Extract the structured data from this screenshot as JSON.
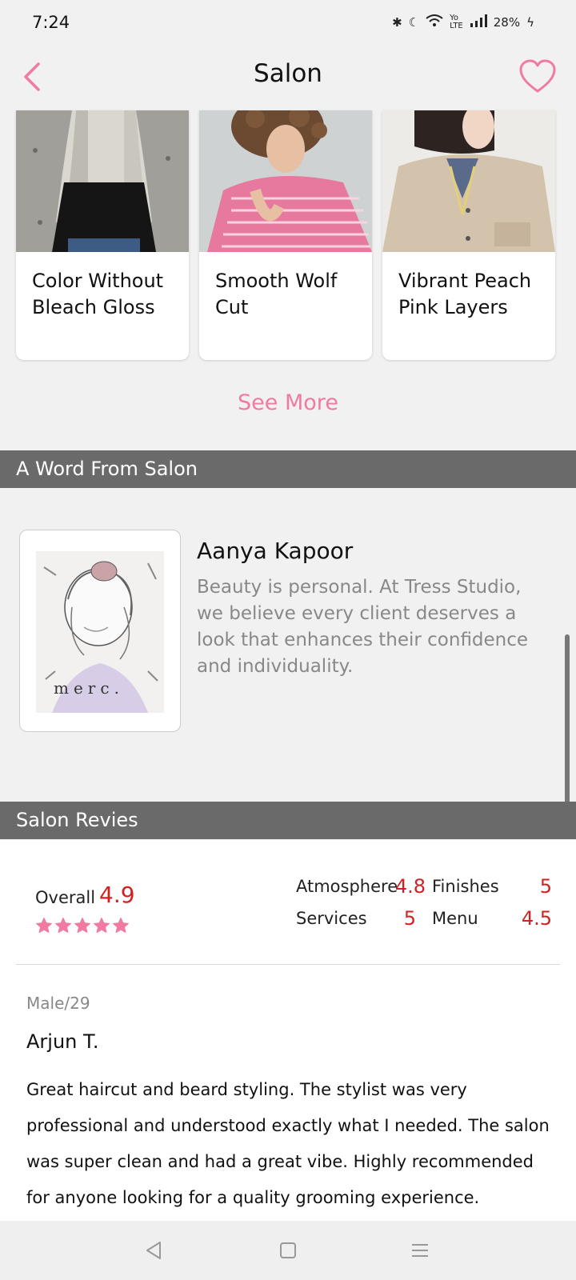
{
  "status_bar": {
    "time": "7:24",
    "battery": "28%"
  },
  "header": {
    "title": "Salon"
  },
  "styles": [
    {
      "name": "Color Without Bleach Gloss"
    },
    {
      "name": "Smooth Wolf Cut"
    },
    {
      "name": "Vibrant Peach Pink Layers"
    }
  ],
  "see_more_label": "See More",
  "word_section": {
    "heading": "A Word From Salon",
    "author": "Aanya Kapoor",
    "quote": "Beauty is personal. At Tress Studio, we believe every client deserves a look that enhances their confidence and individuality."
  },
  "reviews_section": {
    "heading": "Salon Revies",
    "overall_label": "Overall",
    "overall_score": "4.9",
    "star_count": 5,
    "categories": [
      {
        "label": "Atmosphere",
        "score": "4.8"
      },
      {
        "label": "Finishes",
        "score": "5"
      },
      {
        "label": "Services",
        "score": "5"
      },
      {
        "label": "Menu",
        "score": "4.5"
      }
    ],
    "review": {
      "meta": "Male/29",
      "name": "Arjun T.",
      "text": "Great haircut and beard styling. The stylist was very professional and understood exactly what I needed. The salon was super clean and had a great vibe. Highly recommended for anyone looking for a quality grooming experience."
    }
  },
  "colors": {
    "accent_pink": "#f07aa0",
    "score_red": "#d42020",
    "section_gray": "#6a6a6a"
  }
}
